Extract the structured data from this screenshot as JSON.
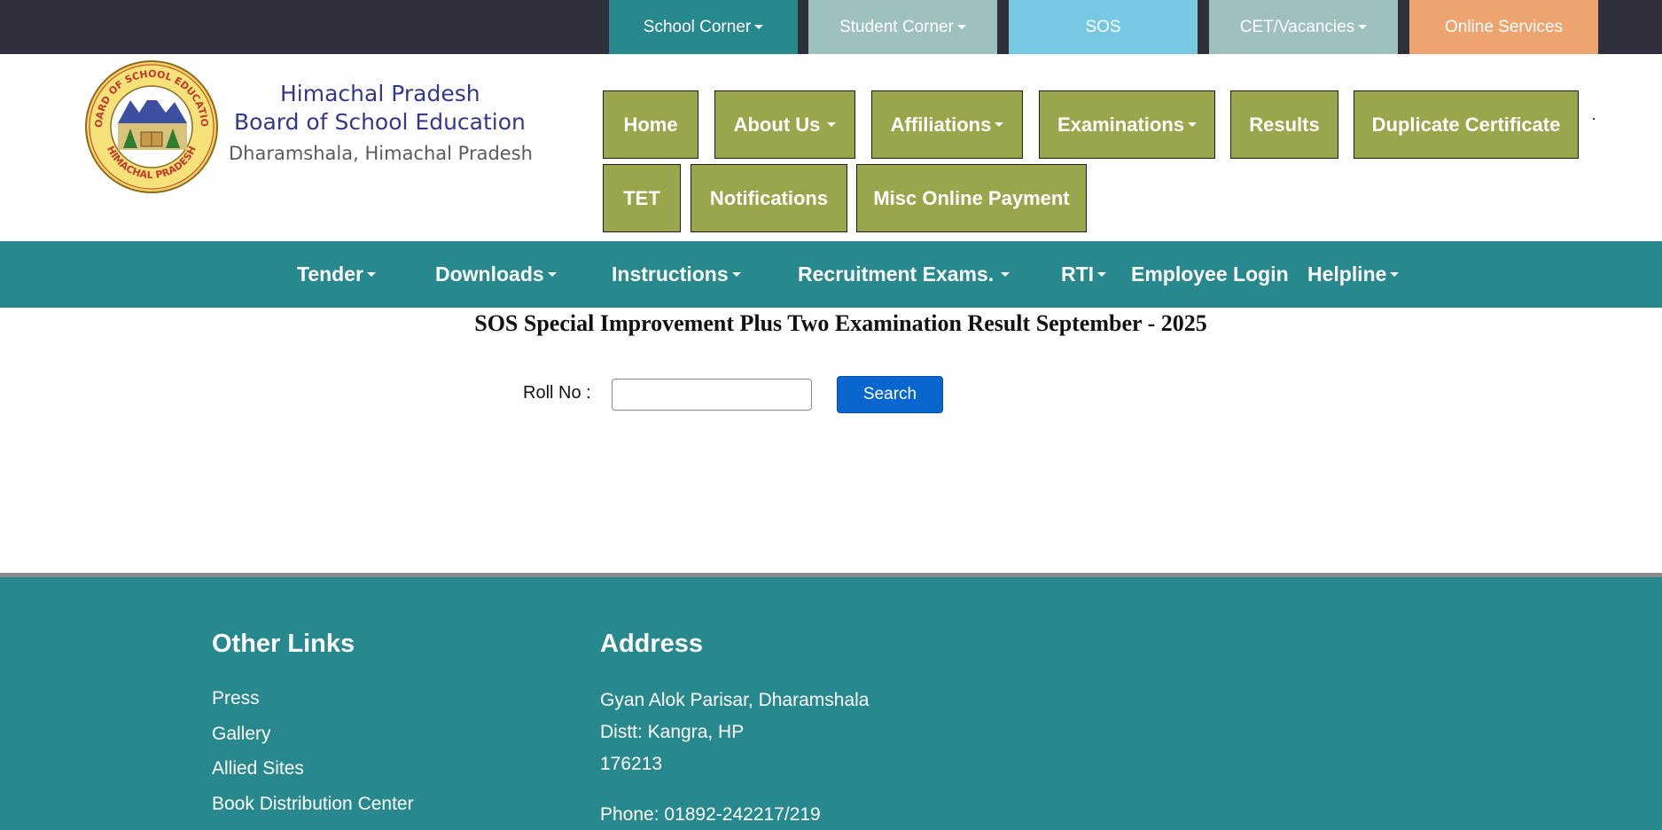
{
  "topbar": {
    "school_corner": "School Corner",
    "student_corner": "Student Corner",
    "sos": "SOS",
    "cet_vacancies": "CET/Vacancies",
    "online_services": "Online Services"
  },
  "colors": {
    "topbar": "#2f303b",
    "school_corner": "#27898e",
    "student_corner": "#9ec1c0",
    "sos": "#77c8e3",
    "cet_vacancies": "#9ec1c0",
    "online_services": "#eea46f",
    "nav_button": "#9aa64b",
    "menu_bar": "#27898e",
    "search_button": "#0a66cf"
  },
  "brand": {
    "line1": "Himachal Pradesh",
    "line2": "Board of School Education",
    "line3": "Dharamshala, Himachal Pradesh",
    "seal_top": "BOARD OF SCHOOL EDUCATION",
    "seal_bottom": "HIMACHAL PRADESH"
  },
  "nav": {
    "home": "Home",
    "about": "About Us",
    "affiliations": "Affiliations",
    "examinations": "Examinations",
    "results": "Results",
    "duplicate": "Duplicate Certificate",
    "tet": "TET",
    "notifications": "Notifications",
    "misc": "Misc Online Payment"
  },
  "menu": {
    "tender": "Tender",
    "downloads": "Downloads",
    "instructions": "Instructions",
    "recruitment": "Recruitment Exams.",
    "rti": "RTI",
    "employee_login": "Employee Login",
    "helpline": "Helpline"
  },
  "main": {
    "title": "SOS Special Improvement Plus Two Examination Result September - 2025",
    "roll_label": "Roll No :",
    "roll_value": "",
    "search_label": "Search"
  },
  "footer": {
    "other_links_heading": "Other Links",
    "links": [
      "Press",
      "Gallery",
      "Allied Sites",
      "Book Distribution Center"
    ],
    "address_heading": "Address",
    "address_lines": [
      "Gyan Alok Parisar, Dharamshala",
      "Distt: Kangra, HP",
      "176213"
    ],
    "phone": "Phone: 01892-242217/219"
  }
}
